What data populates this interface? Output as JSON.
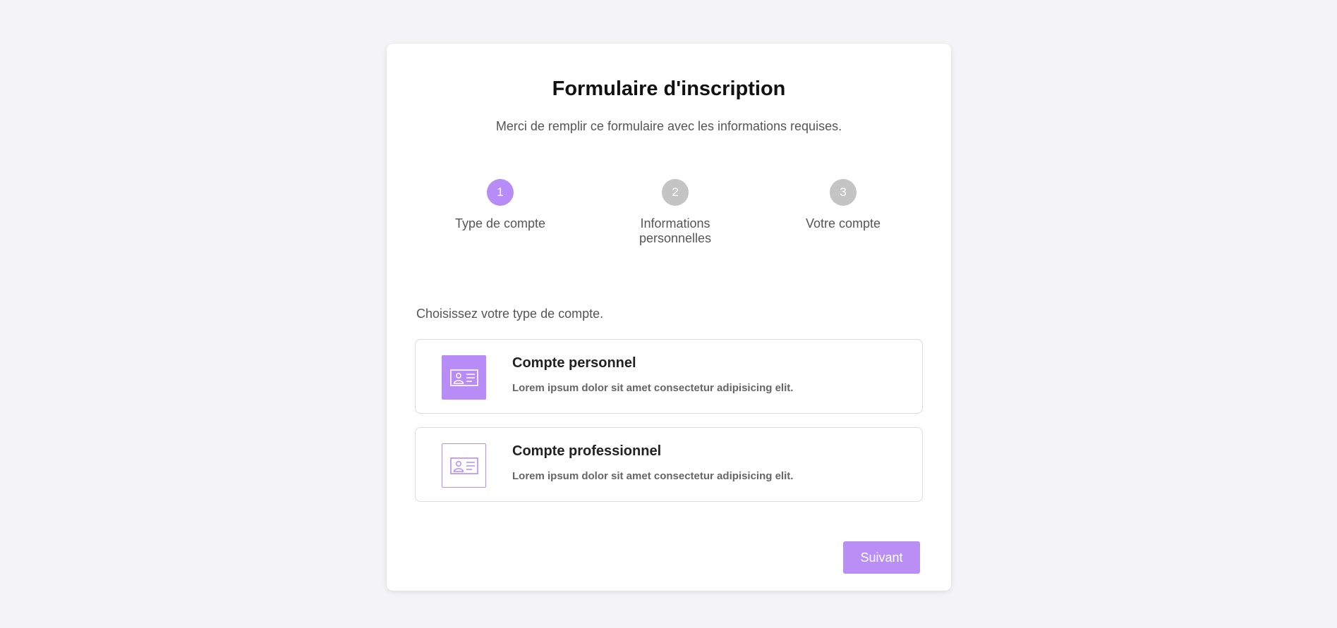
{
  "form": {
    "title": "Formulaire d'inscription",
    "subtitle": "Merci de remplir ce formulaire avec les informations requises."
  },
  "steps": [
    {
      "number": "1",
      "label": "Type de compte",
      "active": true
    },
    {
      "number": "2",
      "label": "Informations personnelles",
      "active": false
    },
    {
      "number": "3",
      "label": "Votre compte",
      "active": false
    }
  ],
  "account_type": {
    "prompt": "Choisissez votre type de compte.",
    "options": [
      {
        "title": "Compte personnel",
        "description": "Lorem ipsum dolor sit amet consectetur adipisicing elit.",
        "icon": "id-card-icon",
        "selected": true
      },
      {
        "title": "Compte professionnel",
        "description": "Lorem ipsum dolor sit amet consectetur adipisicing elit.",
        "icon": "id-card-icon",
        "selected": false
      }
    ]
  },
  "actions": {
    "next_label": "Suivant"
  },
  "colors": {
    "accent": "#b78cf7",
    "inactive_step": "#c4c4c4",
    "background": "#f4f4f8"
  }
}
